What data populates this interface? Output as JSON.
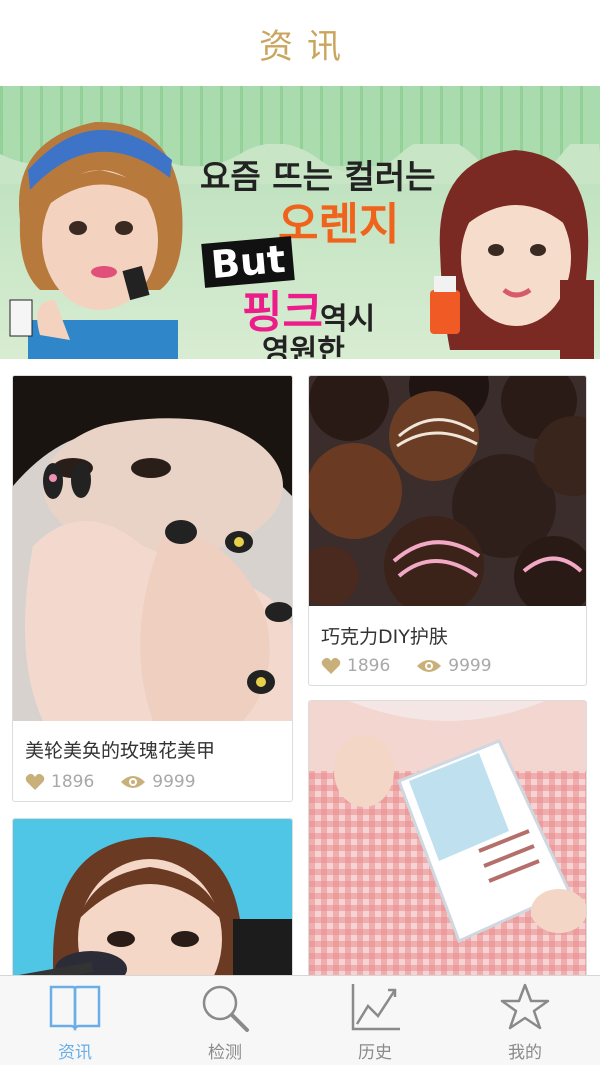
{
  "header": {
    "title": "资讯"
  },
  "banner": {
    "lines": [
      "요즘 뜨는 컬러는",
      "오렌지",
      "But",
      "핑크",
      "역시",
      "영원한"
    ]
  },
  "cards": [
    {
      "title": "美轮美奂的玫瑰花美甲",
      "likes": "1896",
      "views": "9999"
    },
    {
      "title": "巧克力DIY护肤",
      "likes": "1896",
      "views": "9999"
    },
    {
      "title": "",
      "likes": "",
      "views": ""
    },
    {
      "title": "",
      "likes": "",
      "views": ""
    }
  ],
  "tabbar": {
    "active": "资讯",
    "items": [
      {
        "label": "资讯",
        "icon": "book-icon"
      },
      {
        "label": "检测",
        "icon": "search-icon"
      },
      {
        "label": "历史",
        "icon": "chart-icon"
      },
      {
        "label": "我的",
        "icon": "star-icon"
      }
    ]
  },
  "colors": {
    "accent": "#c9a55e",
    "tab_active": "#6aaee8",
    "tab_inactive": "#8a8a8a",
    "stat_icon": "#c9b07a"
  }
}
